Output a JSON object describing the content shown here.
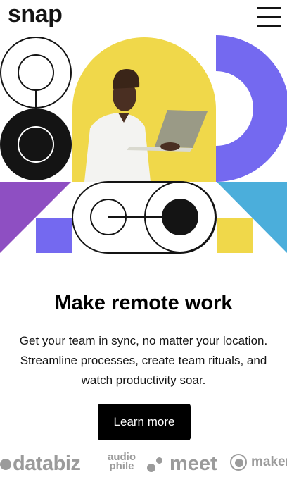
{
  "header": {
    "logo": "snap",
    "menu_icon": "hamburger-icon"
  },
  "hero": {
    "image_alt": "person working on a laptop"
  },
  "content": {
    "headline": "Make remote work",
    "body": "Get your team in sync, no matter your location. Streamline processes, create team rituals, and watch productivity soar.",
    "cta_label": "Learn more"
  },
  "clients": {
    "databiz": "databiz",
    "audiophile_top": "audio",
    "audiophile_bottom": "phile",
    "meet": "meet",
    "maker": "maker"
  },
  "colors": {
    "text": "#141414",
    "yellow": "#f0d84a",
    "purple": "#7469f0",
    "violet": "#8e4fc2",
    "blue": "#4baedb",
    "brand_gray": "#9b9b9b"
  }
}
